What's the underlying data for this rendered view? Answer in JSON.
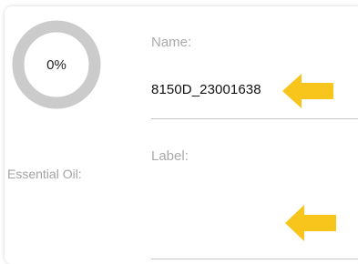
{
  "progress": {
    "percent_label": "0%",
    "value": 0
  },
  "essential_oil": {
    "label": "Essential Oil:"
  },
  "fields": {
    "name": {
      "label": "Name:",
      "value": "8150D_23001638"
    },
    "label": {
      "label": "Label:",
      "value": ""
    }
  },
  "colors": {
    "ring": "#cbcbcb",
    "arrow": "#f8c51c",
    "muted_text": "#a9a9a9",
    "underline": "#c7c7c7"
  },
  "icons": {
    "arrow": "left-arrow-icon"
  }
}
